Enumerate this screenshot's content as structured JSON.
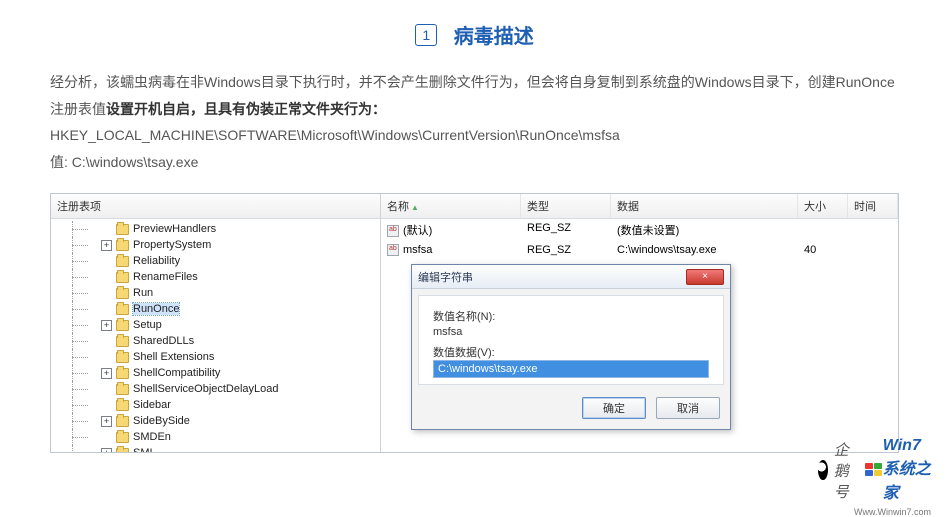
{
  "heading": {
    "number": "1",
    "title": "病毒描述"
  },
  "description": {
    "line1a": "经分析，该蠕虫病毒在非Windows目录下执行时，并不会产生删除文件行为，但会将自身复制到系统盘的Windows目录下，创建RunOnce注册表值",
    "line1b": "设置开机自启，且具有伪装正常文件夹行为：",
    "regpath": "HKEY_LOCAL_MACHINE\\SOFTWARE\\Microsoft\\Windows\\CurrentVersion\\RunOnce\\msfsa",
    "value_label": "值: ",
    "value": "C:\\windows\\tsay.exe"
  },
  "registry": {
    "left_header": "注册表项",
    "tree": [
      {
        "exp": "",
        "label": "PreviewHandlers"
      },
      {
        "exp": "+",
        "label": "PropertySystem"
      },
      {
        "exp": "",
        "label": "Reliability"
      },
      {
        "exp": "",
        "label": "RenameFiles"
      },
      {
        "exp": "",
        "label": "Run"
      },
      {
        "exp": "",
        "label": "RunOnce",
        "sel": true
      },
      {
        "exp": "+",
        "label": "Setup"
      },
      {
        "exp": "",
        "label": "SharedDLLs"
      },
      {
        "exp": "",
        "label": "Shell Extensions"
      },
      {
        "exp": "+",
        "label": "ShellCompatibility"
      },
      {
        "exp": "",
        "label": "ShellServiceObjectDelayLoad"
      },
      {
        "exp": "",
        "label": "Sidebar"
      },
      {
        "exp": "+",
        "label": "SideBySide"
      },
      {
        "exp": "",
        "label": "SMDEn"
      },
      {
        "exp": "+",
        "label": "SMI"
      }
    ],
    "columns": {
      "name": "名称",
      "type": "类型",
      "data": "数据",
      "size": "大小",
      "time": "时间"
    },
    "rows": [
      {
        "name": "(默认)",
        "type": "REG_SZ",
        "data": "(数值未设置)",
        "size": "",
        "time": ""
      },
      {
        "name": "msfsa",
        "type": "REG_SZ",
        "data": "C:\\windows\\tsay.exe",
        "size": "40",
        "time": ""
      }
    ]
  },
  "dialog": {
    "title": "编辑字符串",
    "name_label": "数值名称(N):",
    "name_value": "msfsa",
    "data_label": "数值数据(V):",
    "data_value": "C:\\windows\\tsay.exe",
    "ok": "确定",
    "cancel": "取消",
    "close": "×"
  },
  "watermark": {
    "text1": "企鹅号",
    "brand": "Win7系统之家",
    "sub": "Www.Winwin7.com"
  }
}
